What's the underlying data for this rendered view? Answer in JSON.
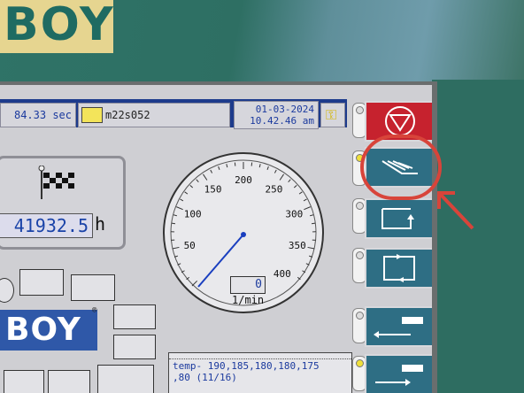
{
  "brand": {
    "housing_text": "BOY",
    "screen_logo": "BOY",
    "registered": "®"
  },
  "status_bar": {
    "cycle_time": "84.33 sec",
    "mold_name": "m22s052",
    "date": "01-03-2024",
    "time": "10.42.46 am",
    "key_icon": "key-icon"
  },
  "counter": {
    "value": "41932.5",
    "unit": "h",
    "icon": "checkered-flag-icon"
  },
  "gauge": {
    "ticks": [
      "50",
      "100",
      "150",
      "200",
      "250",
      "300",
      "350",
      "400"
    ],
    "readout": "0",
    "unit": "1/min"
  },
  "notes": {
    "line1": "temp- 190,185,180,180,175",
    "line2": ",80 (11/16)"
  },
  "side_buttons": [
    {
      "name": "stop-button",
      "icon": "stop-triangle-icon",
      "color": "#c6222e"
    },
    {
      "name": "manual-mode-button",
      "icon": "hand-icon",
      "color": "#2e6e84",
      "highlighted": true
    },
    {
      "name": "semi-auto-button",
      "icon": "half-cycle-icon",
      "color": "#2e6e84"
    },
    {
      "name": "full-auto-button",
      "icon": "full-cycle-icon",
      "color": "#2e6e84"
    },
    {
      "name": "nozzle-retract-button",
      "icon": "nozzle-retract-icon",
      "color": "#2e6e84"
    },
    {
      "name": "nozzle-advance-button",
      "icon": "nozzle-advance-icon",
      "color": "#2e6e84"
    }
  ],
  "colors": {
    "screen_bg": "#cfcfd3",
    "title_bar": "#1d3b8c",
    "highlight": "#d8443a",
    "housing": "#2c6b60"
  }
}
